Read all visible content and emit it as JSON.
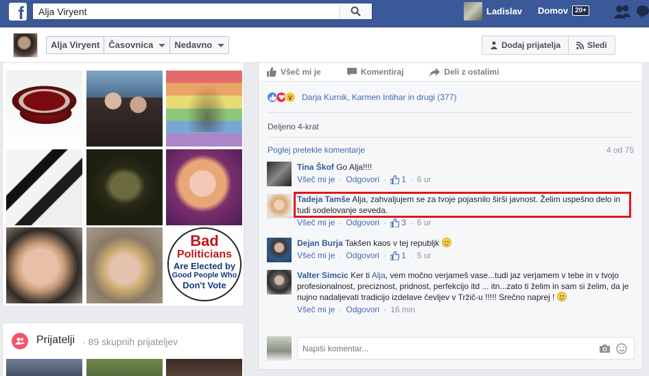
{
  "topbar": {
    "logo": "f",
    "search_value": "Alja Viryent",
    "user_name": "Ladislav",
    "home_label": "Domov",
    "home_badge": "20+"
  },
  "subnav": {
    "name": "Alja Viryent",
    "timeline": "Časovnica",
    "recent": "Nedavno",
    "add_friend": "Dodaj prijatelja",
    "follow": "Sledi"
  },
  "photos": {
    "poster": {
      "line1": "Bad",
      "line2": "Politicians",
      "line3": "Are Elected by",
      "line4": "Good People Who",
      "line5": "Don't Vote"
    }
  },
  "friends": {
    "title": "Prijatelji",
    "count": "· 89 skupnih prijateljev"
  },
  "post": {
    "actions": {
      "like": "Všeč mi je",
      "comment": "Komentiraj",
      "share": "Deli z ostalimi"
    },
    "reaction_names": "Darja Kurnik, Karmen Intihar in drugi (377)",
    "shared": "Deljeno 4-krat",
    "view_previous": "Poglej pretekle komentarje",
    "comment_count": "4 od 75",
    "comments": [
      {
        "name": "Tina Škof",
        "text": "Go Alja!!!!",
        "like": "Všeč mi je",
        "reply": "Odgovori",
        "likes": "1",
        "time": "6 ur"
      },
      {
        "name": "Tadeja Tamše",
        "text": "Alja, zahvaljujem se za tvoje pojasnilo širši javnost. Želim uspešno delo in tudi sodelovanje seveda.",
        "like": "Všeč mi je",
        "reply": "Odgovori",
        "likes": "3",
        "time": "6 ur"
      },
      {
        "name": "Dejan Burja",
        "text": "Takšen kaos v tej republjk",
        "like": "Všeč mi je",
        "reply": "Odgovori",
        "likes": "1",
        "time": "5 ur"
      },
      {
        "name": "Valter Simcic",
        "text_pre": "Ker ti",
        "mention": "Alja",
        "text": ", vem močno verjameš vase...tudi jaz verjamem v tebe in v tvojo profesionalnost, preciznost, pridnost, perfekcijo itd ... itn...zato ti želim in sam si želim, da je nujno nadaljevati tradicijo izdelave čevljev v Tržič-u !!!!! Srečno naprej !",
        "like": "Všeč mi je",
        "reply": "Odgovori",
        "time": "16 min"
      }
    ],
    "write_placeholder": "Napiši komentar..."
  },
  "colors": {
    "brand": "#3b5998",
    "link": "#365899",
    "highlight": "#e3141b"
  },
  "icons": [
    "search-icon",
    "friends-requests-icon",
    "messages-icon",
    "add-friend-icon",
    "rss-icon",
    "like-icon",
    "comment-icon",
    "share-icon",
    "camera-icon",
    "emoji-icon"
  ]
}
